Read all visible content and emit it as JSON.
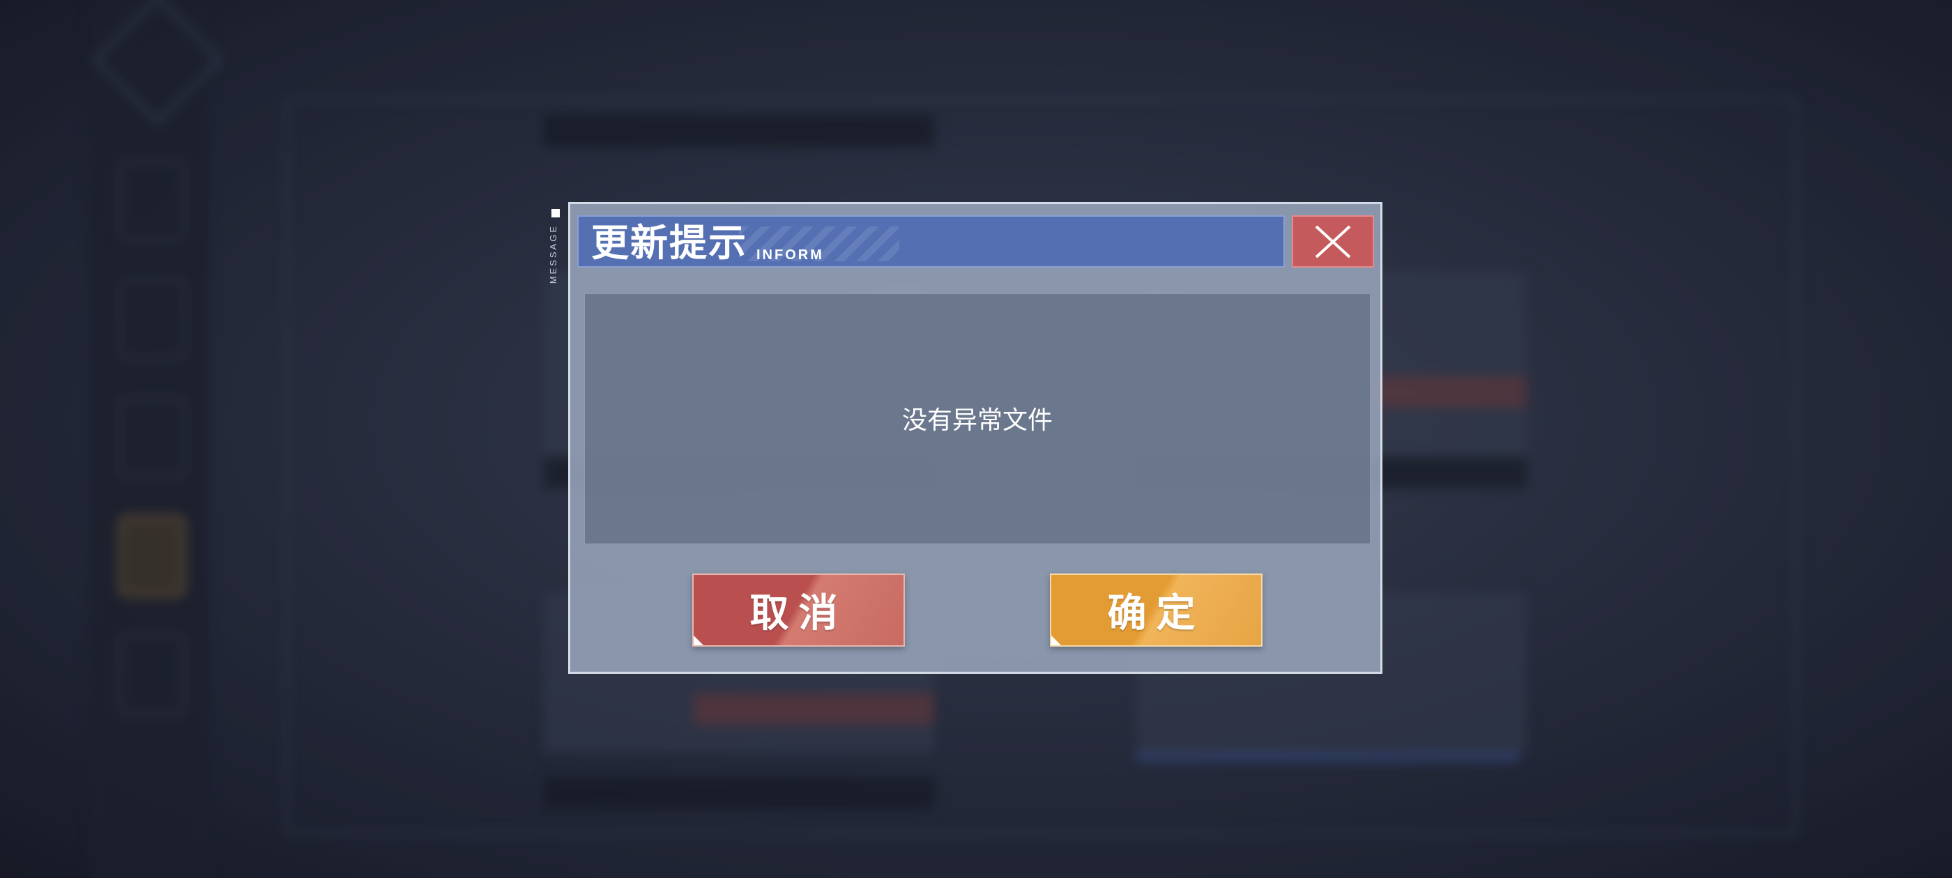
{
  "dialog": {
    "title": "更新提示",
    "subtitle": "INFORM",
    "side_tag": "MESSAGE",
    "message": "没有异常文件",
    "cancel_label": "取消",
    "confirm_label": "确定"
  },
  "colors": {
    "header": "#5470b3",
    "close": "#c55a5c",
    "cancel": "#b9504f",
    "confirm": "#e39b33"
  },
  "icons": {
    "close": "close-icon",
    "back": "back-arrow-icon"
  }
}
